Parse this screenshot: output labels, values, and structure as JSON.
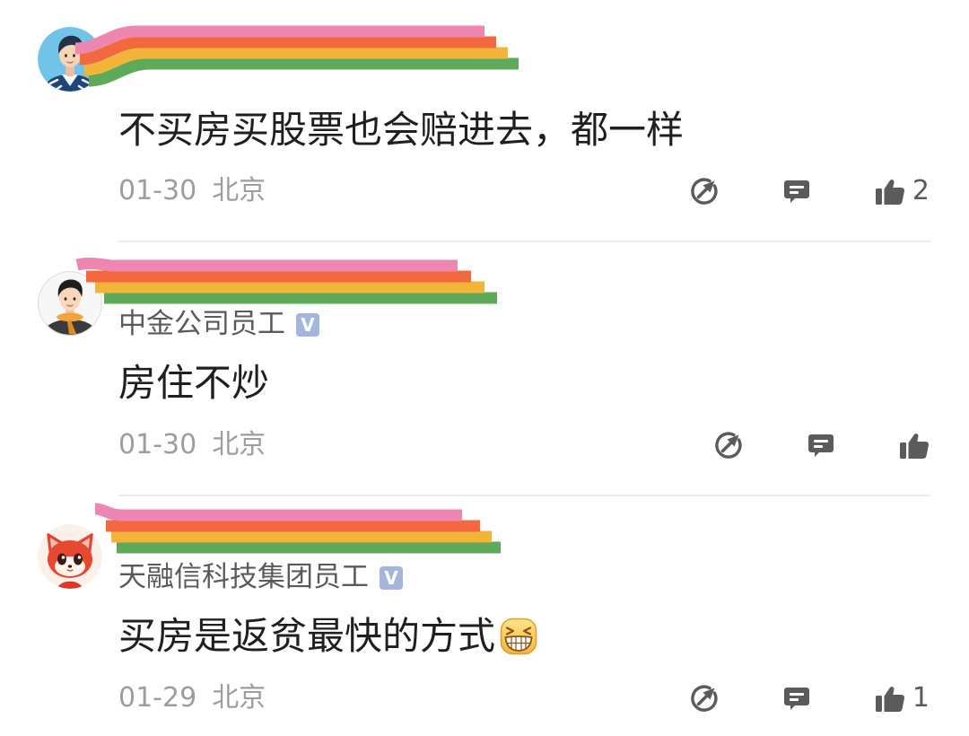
{
  "colors": {
    "text_primary": "#1f1f1f",
    "text_secondary": "#5a5a5a",
    "text_meta": "#9d9d9d",
    "icon": "#5b5b5b",
    "badge_bg": "#a4b6dc",
    "divider": "#ececec",
    "redaction_pink": "#ef86b2",
    "redaction_red": "#f2693f",
    "redaction_yellow": "#f3b43a",
    "redaction_green": "#5eaa5a"
  },
  "icons": {
    "share": "share-icon",
    "reply": "comment-bubble-icon",
    "like": "thumbs-up-icon"
  },
  "comments": [
    {
      "avatar": "man-blue-jacket-avatar",
      "text": "不买房买股票也会赔进去，都一样",
      "date": "01-30",
      "location": "北京",
      "like_count": "2"
    },
    {
      "avatar": "man-orange-scarf-avatar",
      "title": "中金公司员工",
      "badge": "V",
      "text": "房住不炒",
      "date": "01-30",
      "location": "北京"
    },
    {
      "avatar": "red-fox-avatar",
      "title": "天融信科技集团员工",
      "badge": "V",
      "text": "买房是返贫最快的方式",
      "emoji": "grinning-squinting-face-icon",
      "date": "01-29",
      "location": "北京",
      "like_count": "1"
    }
  ]
}
